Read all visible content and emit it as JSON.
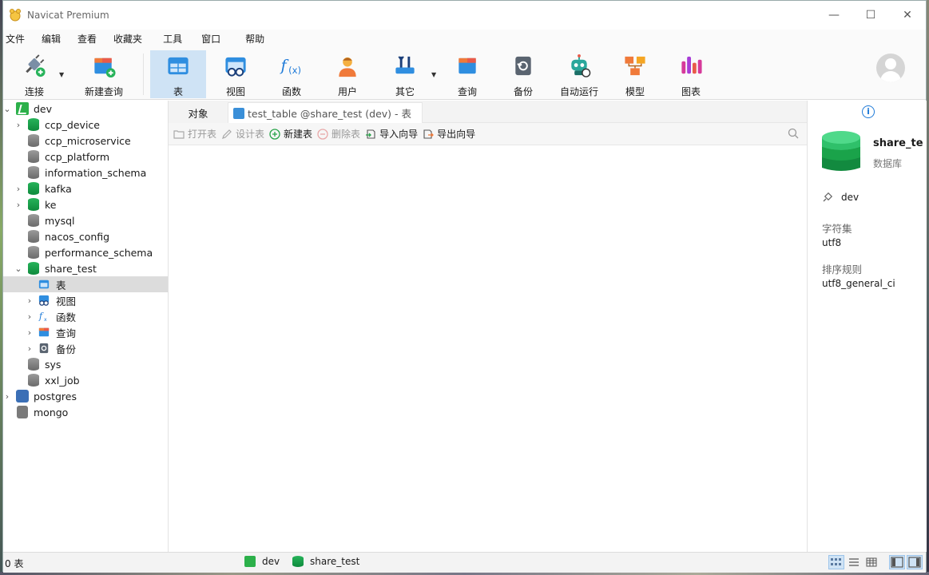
{
  "window": {
    "title": "Navicat Premium"
  },
  "window_controls": {
    "minimize": "—",
    "maximize": "☐",
    "close": "✕"
  },
  "menu": [
    "文件",
    "编辑",
    "查看",
    "收藏夹",
    "工具",
    "窗口",
    "帮助"
  ],
  "toolbar": {
    "connect": "连接",
    "new_query": "新建查询",
    "table": "表",
    "view": "视图",
    "function": "函数",
    "user": "用户",
    "other": "其它",
    "query": "查询",
    "backup": "备份",
    "automation": "自动运行",
    "model": "模型",
    "chart": "图表"
  },
  "tree": {
    "dev": "dev",
    "ccp_device": "ccp_device",
    "ccp_microservice": "ccp_microservice",
    "ccp_platform": "ccp_platform",
    "information_schema": "information_schema",
    "kafka": "kafka",
    "ke": "ke",
    "mysql": "mysql",
    "nacos_config": "nacos_config",
    "performance_schema": "performance_schema",
    "share_test": "share_test",
    "tables": "表",
    "views": "视图",
    "functions": "函数",
    "queries": "查询",
    "backups": "备份",
    "sys": "sys",
    "xxl_job": "xxl_job",
    "postgres": "postgres",
    "mongo": "mongo"
  },
  "tabs": {
    "objects": "对象",
    "table_tab": "test_table @share_test (dev) - 表"
  },
  "object_toolbar": {
    "open_table": "打开表",
    "design_table": "设计表",
    "new_table": "新建表",
    "delete_table": "删除表",
    "import_wizard": "导入向导",
    "export_wizard": "导出向导"
  },
  "info": {
    "name": "share_test",
    "type": "数据库",
    "connection": "dev",
    "charset_label": "字符集",
    "charset": "utf8",
    "collation_label": "排序规则",
    "collation": "utf8_general_ci"
  },
  "status": {
    "count": "0 表",
    "connection": "dev",
    "database": "share_test"
  },
  "colors": {
    "accent": "#1e7ad8",
    "selected_row": "#dcdcdc",
    "active_tool": "#cfe3f5",
    "db_green": "#1aa34a"
  }
}
